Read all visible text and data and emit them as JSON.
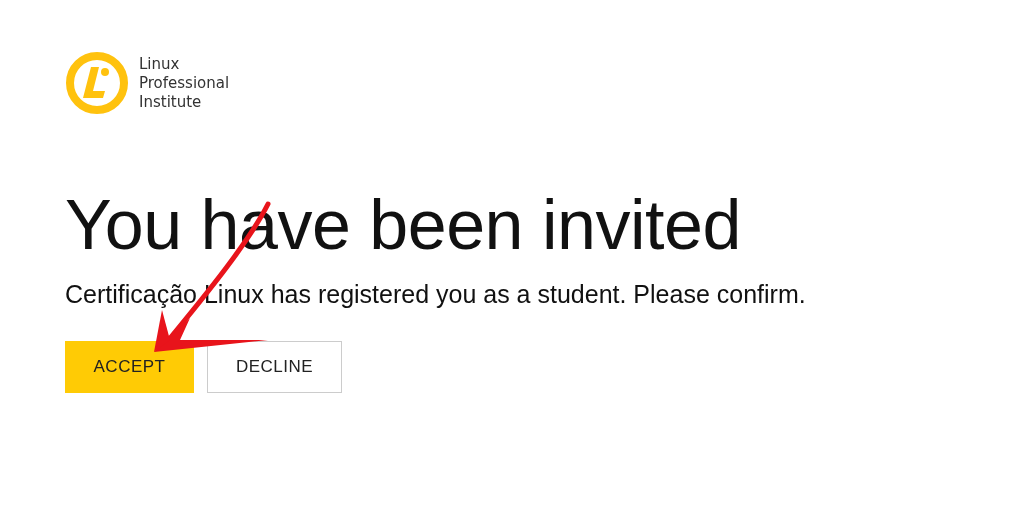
{
  "logo": {
    "lines": [
      "Linux",
      "Professional",
      "Institute"
    ]
  },
  "heading": "You have been invited",
  "message": "Certificação Linux has registered you as a student. Please confirm.",
  "buttons": [
    {
      "label": "ACCEPT",
      "kind": "primary"
    },
    {
      "label": "DECLINE",
      "kind": "secondary"
    }
  ]
}
